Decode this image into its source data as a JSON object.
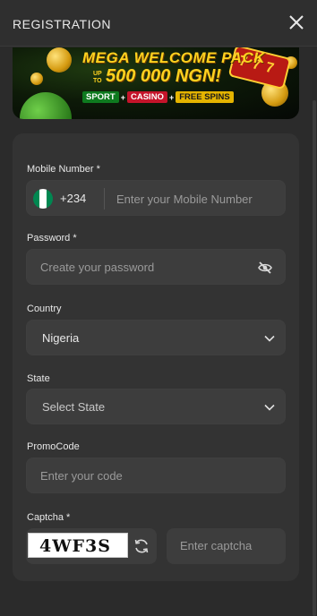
{
  "header": {
    "title": "REGISTRATION"
  },
  "banner": {
    "line1": "MEGA WELCOME PACK",
    "upto": "UP TO",
    "line2": "500 000 NGN!",
    "tag_sport": "SPORT",
    "tag_casino": "CASINO",
    "tag_spins": "FREE SPINS",
    "slot_text": "7 7 7"
  },
  "form": {
    "mobile": {
      "label": "Mobile Number *",
      "prefix": "+234",
      "placeholder": "Enter your Mobile Number",
      "flag_colors": [
        "#008751",
        "#ffffff",
        "#008751"
      ]
    },
    "password": {
      "label": "Password *",
      "placeholder": "Create your password"
    },
    "country": {
      "label": "Country",
      "value": "Nigeria"
    },
    "state": {
      "label": "State",
      "value": "Select State"
    },
    "promo": {
      "label": "PromoCode",
      "placeholder": "Enter your code"
    },
    "captcha": {
      "label": "Captcha *",
      "code": "4WF3S",
      "placeholder": "Enter captcha"
    }
  },
  "colors": {
    "brand_yellow": "#ffd21f",
    "background": "#2b2b2b",
    "card": "#333333"
  }
}
